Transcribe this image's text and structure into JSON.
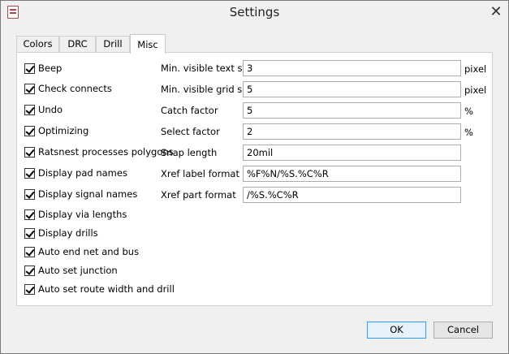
{
  "window": {
    "title": "Settings",
    "close_glyph": "✕",
    "app_icon": "application-icon"
  },
  "tabs": [
    {
      "label": "Colors",
      "active": false
    },
    {
      "label": "DRC",
      "active": false
    },
    {
      "label": "Drill",
      "active": false
    },
    {
      "label": "Misc",
      "active": true
    }
  ],
  "checkboxes": [
    {
      "label": "Beep",
      "checked": true
    },
    {
      "label": "Check connects",
      "checked": true
    },
    {
      "label": "Undo",
      "checked": true
    },
    {
      "label": "Optimizing",
      "checked": true
    },
    {
      "label": "Ratsnest processes polygons",
      "checked": true
    },
    {
      "label": "Display pad names",
      "checked": true
    },
    {
      "label": "Display signal names",
      "checked": true
    },
    {
      "label": "Display via lengths",
      "checked": true
    },
    {
      "label": "Display drills",
      "checked": true
    },
    {
      "label": "Auto end net and bus",
      "checked": true
    },
    {
      "label": "Auto set junction",
      "checked": true
    },
    {
      "label": "Auto set route width and drill",
      "checked": true
    }
  ],
  "fields": [
    {
      "label": "Min. visible text size",
      "value": "3",
      "unit": "pixel"
    },
    {
      "label": "Min. visible grid size",
      "value": "5",
      "unit": "pixel"
    },
    {
      "label": "Catch factor",
      "value": "5",
      "unit": "%"
    },
    {
      "label": "Select factor",
      "value": "2",
      "unit": "%"
    },
    {
      "label": "Snap length",
      "value": "20mil",
      "unit": ""
    },
    {
      "label": "Xref label format",
      "value": "%F%N/%S.%C%R",
      "unit": ""
    },
    {
      "label": "Xref part format",
      "value": "/%S.%C%R",
      "unit": ""
    }
  ],
  "buttons": {
    "ok": "OK",
    "cancel": "Cancel"
  }
}
